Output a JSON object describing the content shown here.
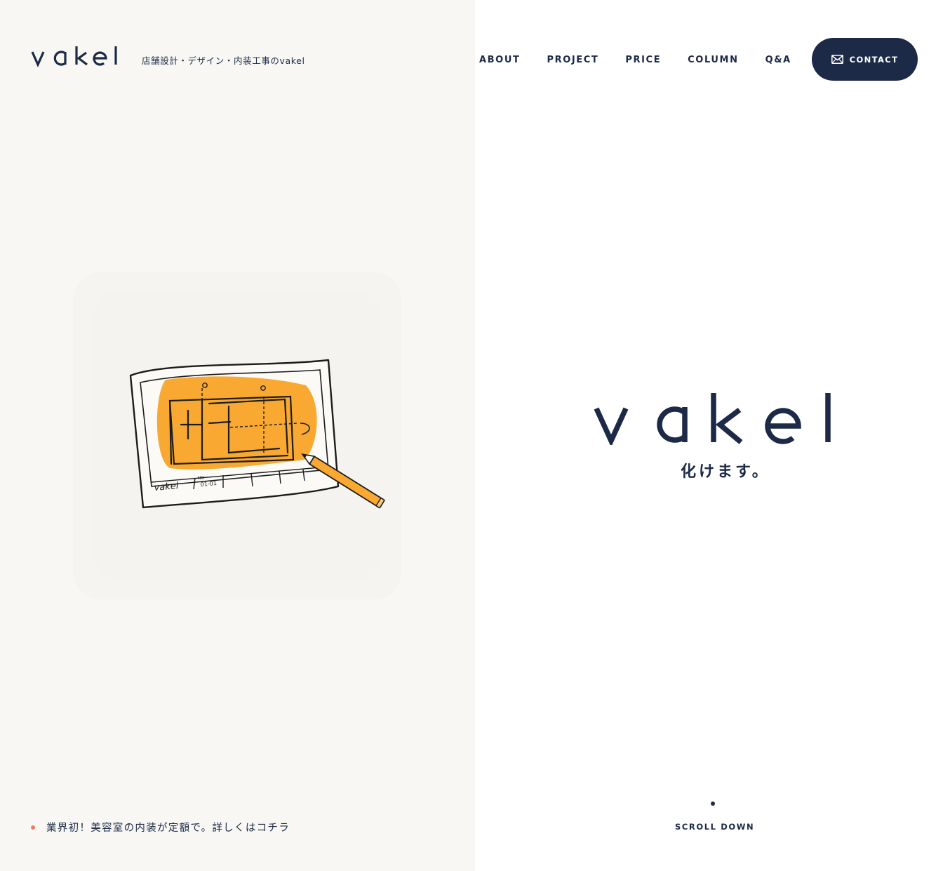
{
  "brand": {
    "logo_text": "vakel",
    "tagline": "店舗設計・デザイン・内装工事のvakel"
  },
  "nav": {
    "items": [
      {
        "label": "ABOUT"
      },
      {
        "label": "PROJECT"
      },
      {
        "label": "PRICE"
      },
      {
        "label": "COLUMN"
      },
      {
        "label": "Q&A"
      }
    ],
    "contact_label": "CONTACT",
    "contact_icon": "mail-icon"
  },
  "hero": {
    "logo_text": "vakel",
    "subtitle": "化けます。"
  },
  "illustration": {
    "icon": "floor-plan-sketch",
    "sheet_labels": [
      "vakel",
      "NO",
      "01-01"
    ]
  },
  "news": {
    "text": "業界初！美容室の内装が定額で。詳しくはコチラ"
  },
  "scroll": {
    "label": "SCROLL DOWN"
  },
  "colors": {
    "navy": "#1c2a47",
    "left_bg": "#f8f7f3",
    "orange": "#f9a832",
    "news_dot": "#ef7b63"
  }
}
